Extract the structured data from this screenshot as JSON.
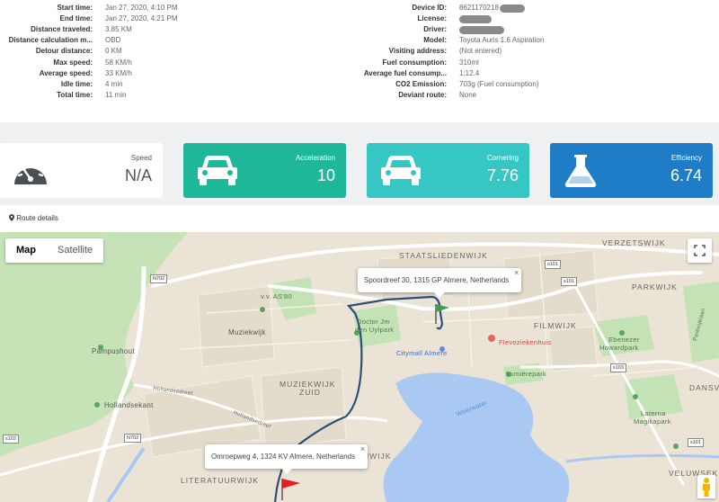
{
  "trip": {
    "left": [
      {
        "label": "Start time:",
        "value": "Jan 27, 2020, 4:10 PM"
      },
      {
        "label": "End time:",
        "value": "Jan 27, 2020, 4:21 PM"
      },
      {
        "label": "Distance traveled:",
        "value": "3.85 KM"
      },
      {
        "label": "Distance calculation m...",
        "value": "OBD"
      },
      {
        "label": "Detour distance:",
        "value": "0 KM"
      },
      {
        "label": "Max speed:",
        "value": "58 KM/h"
      },
      {
        "label": "Average speed:",
        "value": "33 KM/h"
      },
      {
        "label": "Idle time:",
        "value": "4 min"
      },
      {
        "label": "Total time:",
        "value": "11 min"
      }
    ],
    "right": [
      {
        "label": "Device ID:",
        "value": "8621170218"
      },
      {
        "label": "License:",
        "value": ""
      },
      {
        "label": "Driver:",
        "value": ""
      },
      {
        "label": "Model:",
        "value": "Toyota Auris 1.6 Aspiration"
      },
      {
        "label": "Visiting address:",
        "value": "(Not entered)"
      },
      {
        "label": "Fuel consumption:",
        "value": "310ml"
      },
      {
        "label": "Average fuel consump...",
        "value": "1:12.4"
      },
      {
        "label": "CO2 Emission:",
        "value": "703g (Fuel consumption)"
      },
      {
        "label": "Deviant route:",
        "value": "None"
      }
    ]
  },
  "cards": {
    "speed": {
      "label": "Speed",
      "value": "N/A",
      "icon": "speedometer-icon"
    },
    "acceleration": {
      "label": "Acceleration",
      "value": "10",
      "icon": "car-icon"
    },
    "cornering": {
      "label": "Cornering",
      "value": "7.76",
      "icon": "car-icon"
    },
    "efficiency": {
      "label": "Efficiency",
      "value": "6.74",
      "icon": "flask-icon"
    }
  },
  "route": {
    "header": "Route details",
    "icon": "map-marker-icon"
  },
  "map": {
    "tabs": {
      "map": "Map",
      "satellite": "Satellite"
    },
    "end_popup": "Spoordreef 30, 1315 GP Almere, Netherlands",
    "start_popup": "Omroepweg 4, 1324 KV Almere, Netherlands",
    "labels": {
      "staatsliedenwijk": "STAATSLIEDENWIJK",
      "verzetswijk": "VERZETSWIJK",
      "parkwijk": "PARKWIJK",
      "filmwijk": "FILMWIJK",
      "muziekwijk": "Muziekwijk",
      "muziekwijk_zuid_1": "MUZIEKWIJK",
      "muziekwijk_zuid_2": "ZUID",
      "literatuurwijk": "LITERATUURWIJK",
      "danswijk": "DANSV",
      "veluwsek": "VELUWSEK",
      "nwijk": "NWIJK",
      "pampushout": "Pampushout",
      "hollandsekant": "Hollandsekant",
      "vv_as80": "v.v. AS'80",
      "doctor_park_1": "Doctor Jm",
      "doctor_park_2": "den Uylpark",
      "citymall": "Citymall Almere",
      "flevoziekenhuis": "Flevoziekenhuis",
      "lumierepark": "Lumièrepark",
      "ebenezer_1": "Ebenezer",
      "ebenezer_2": "Howardpark",
      "laterna_1": "Laterna",
      "laterna_2": "Magikapark",
      "veluwse_kant": "Veluwse Kant",
      "weerwater": "Weerwater",
      "hollandsedreef": "Hollandsedreef",
      "hollandsedreef2": "Hollandsedreef",
      "parkweg": "Parkwijklaan"
    },
    "shields": {
      "n702a": "N702",
      "n702b": "N702",
      "s101a": "s101",
      "s101b": "s101",
      "s102": "s102",
      "s103": "s103",
      "s101c": "s101"
    },
    "colors": {
      "route": "#2c4d7a",
      "start_flag": "#e02020",
      "end_flag": "#3aa34a",
      "water": "#a9c9f2",
      "park": "#c4e3b5"
    }
  }
}
